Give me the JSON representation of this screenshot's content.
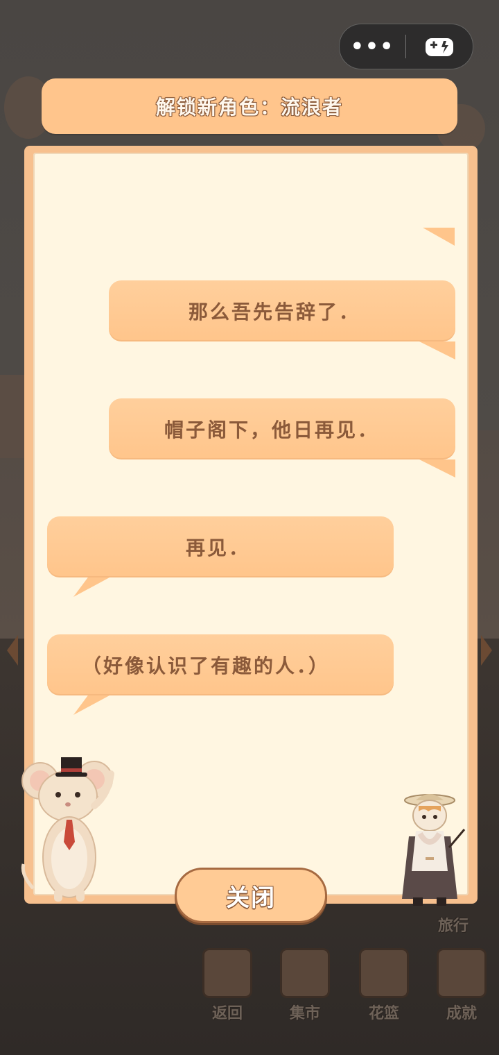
{
  "header": {
    "title": "解锁新角色：流浪者",
    "menu_dots": "•••"
  },
  "dialogue": [
    {
      "speaker": "wanderer",
      "text": "那么吾先告辞了．"
    },
    {
      "speaker": "wanderer",
      "text": "帽子阁下，他日再见．"
    },
    {
      "speaker": "mouse",
      "text": "再见．"
    },
    {
      "speaker": "mouse",
      "text": "（好像认识了有趣的人．）"
    }
  ],
  "close_button": {
    "label": "关闭"
  },
  "bottom_nav": {
    "items": [
      {
        "label": "返回",
        "icon": "door-icon"
      },
      {
        "label": "集市",
        "icon": "market-stall-icon"
      },
      {
        "label": "花篮",
        "icon": "flower-basket-icon"
      },
      {
        "label": "成就",
        "icon": "trophy-icon"
      }
    ],
    "travel_label": "旅行"
  },
  "colors": {
    "panel_border": "#f7c08e",
    "panel_fill": "#fff6e1",
    "bubble": "#ffc58b",
    "bubble_text": "#8b5a3a"
  }
}
